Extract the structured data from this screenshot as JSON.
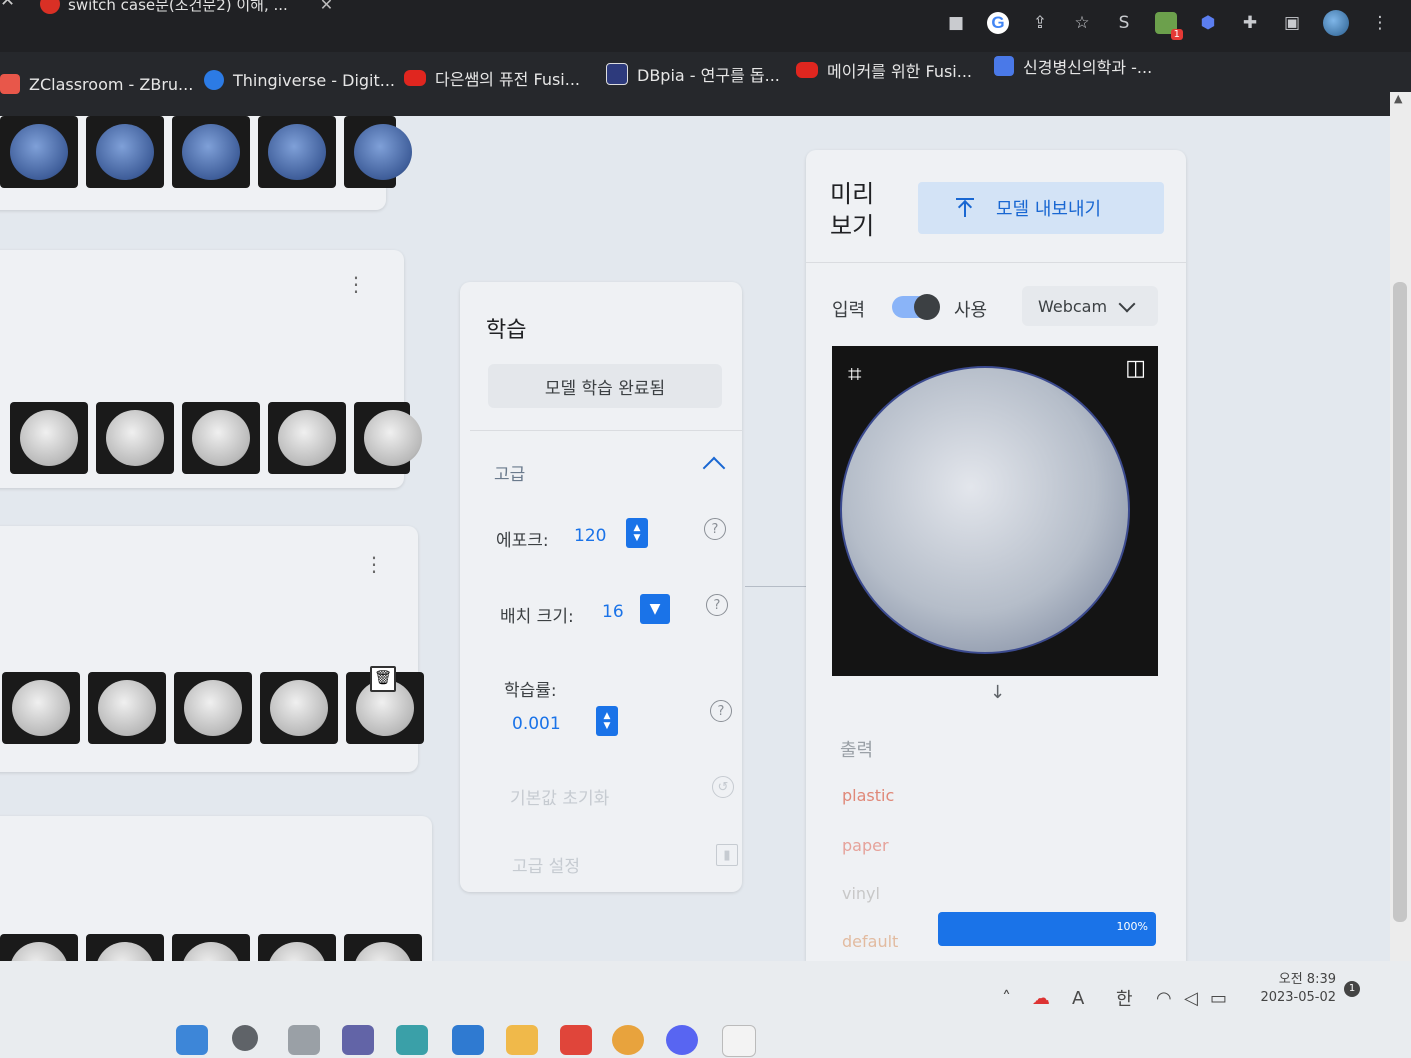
{
  "browser": {
    "tab_title": "switch case문(조건문2) 이해, ...",
    "toolbar_icons": [
      "camera-icon",
      "google-icon",
      "share-icon",
      "star-icon",
      "s-extension-icon",
      "extension-badge-icon",
      "shield-extension-icon",
      "puzzle-icon",
      "sidepanel-icon",
      "profile-avatar",
      "menu-dots-icon"
    ],
    "extension_badge": "1",
    "bookmarks": [
      {
        "label": "ZClassroom - ZBru...",
        "icon": "zclassroom-icon"
      },
      {
        "label": "Thingiverse - Digit...",
        "icon": "thingiverse-icon"
      },
      {
        "label": "다은쌤의 퓨전 Fusi...",
        "icon": "youtube-icon"
      },
      {
        "label": "DBpia - 연구를 돕...",
        "icon": "dbpia-icon"
      },
      {
        "label": "메이커를 위한 Fusi...",
        "icon": "youtube-icon"
      },
      {
        "label": "신경병신의학과 -...",
        "icon": "docs-icon"
      }
    ]
  },
  "train": {
    "title": "학습",
    "status_button": "모델 학습 완료됨",
    "advanced_label": "고급",
    "epochs_label": "에포크:",
    "epochs_value": "120",
    "batch_label": "배치 크기:",
    "batch_value": "16",
    "lr_label": "학습률:",
    "lr_value": "0.001",
    "reset_label": "기본값 초기화",
    "details_label": "고급 설정"
  },
  "preview": {
    "title_line1": "미리",
    "title_line2": "보기",
    "export_label": "모델 내보내기",
    "input_label": "입력",
    "use_label": "사용",
    "toggle_on": true,
    "source_select": "Webcam",
    "output_label": "출력",
    "classes": [
      {
        "name": "plastic",
        "confidence": 0
      },
      {
        "name": "paper",
        "confidence": 0
      },
      {
        "name": "vinyl",
        "confidence": 0
      },
      {
        "name": "default",
        "confidence": 1.0,
        "confidence_label": "100%"
      }
    ]
  },
  "taskbar": {
    "tray_language_a": "A",
    "tray_language_ko": "한",
    "time": "오전 8:39",
    "date": "2023-05-02",
    "notification_count": "1"
  },
  "colors": {
    "accent": "#1a73e8",
    "export_bg": "#d3e3f6",
    "page_bg": "#e3e8ee",
    "class_text": "#e38a7a"
  }
}
